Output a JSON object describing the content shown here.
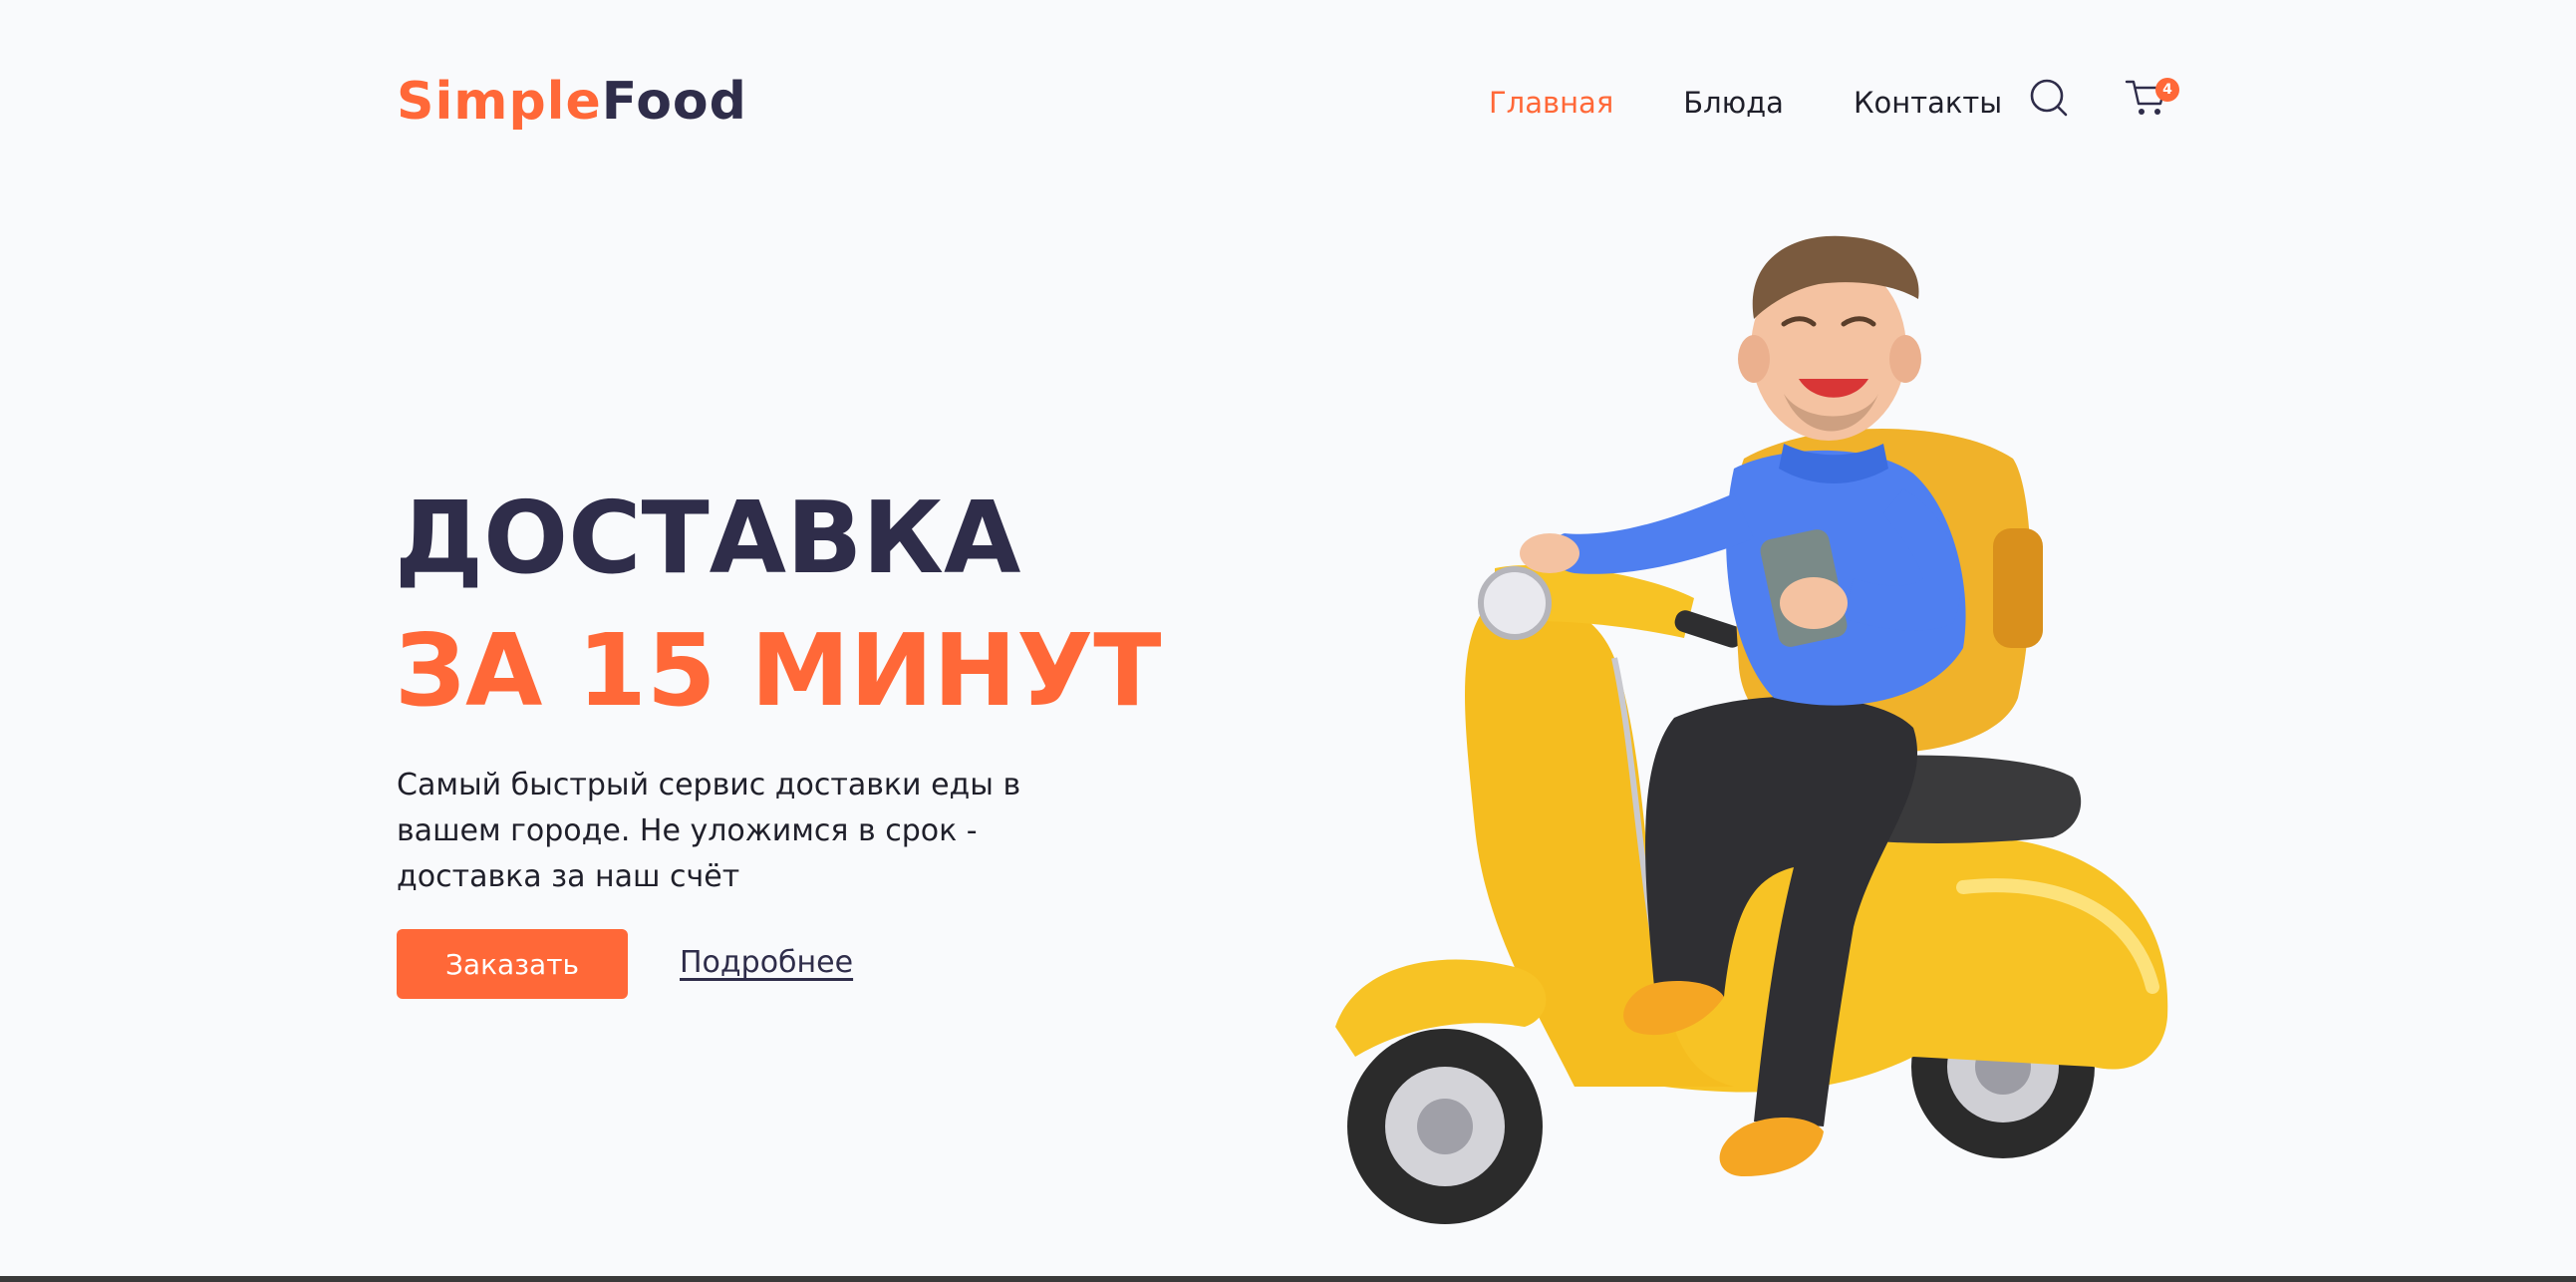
{
  "header": {
    "logo_part1": "Simple",
    "logo_part2": "Food",
    "nav": [
      {
        "label": "Главная",
        "active": true
      },
      {
        "label": "Блюда",
        "active": false
      },
      {
        "label": "Контакты",
        "active": false
      }
    ],
    "search_icon": "search-icon",
    "cart_icon": "cart-icon",
    "cart_count": "4"
  },
  "hero": {
    "title_line1": "ДОСТАВКА",
    "title_line2": "ЗА 15 МИНУТ",
    "description": "Самый быстрый сервис доставки еды в вашем городе. Не уложимся в срок - доставка за наш счёт",
    "order_button": "Заказать",
    "more_link": "Подробнее"
  },
  "colors": {
    "accent": "#ff6838",
    "dark": "#2f2d4a",
    "background": "#f9fafc",
    "scooter_yellow": "#f7c325",
    "shirt_blue": "#4f7ff0"
  },
  "illustration": "courier-on-scooter"
}
